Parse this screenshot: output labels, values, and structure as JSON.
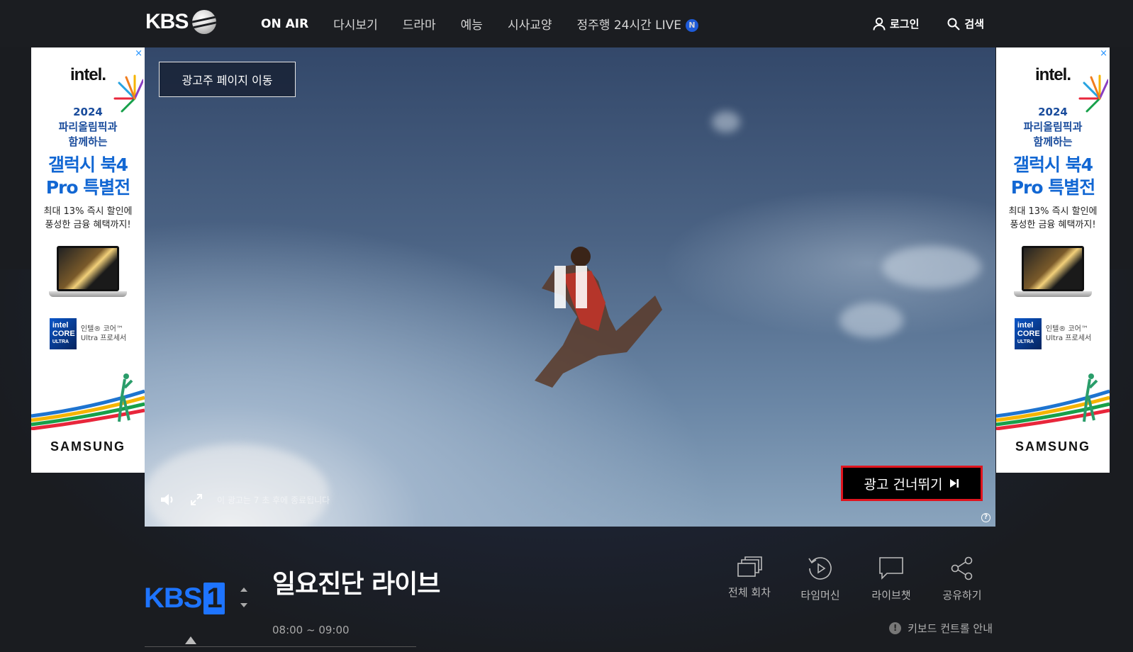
{
  "header": {
    "logo_text": "KBS",
    "nav": [
      {
        "label": "ON AIR",
        "active": true
      },
      {
        "label": "다시보기"
      },
      {
        "label": "드라마"
      },
      {
        "label": "예능"
      },
      {
        "label": "시사교양"
      },
      {
        "label": "정주행 24시간 LIVE",
        "badge": "N"
      }
    ],
    "login_label": "로그인",
    "search_label": "검색"
  },
  "side_ad": {
    "close_symbol": "×",
    "brand": "intel.",
    "year": "2024",
    "line1": "파리올림픽과",
    "line2": "함께하는",
    "headline1": "갤럭시 북4",
    "headline2": "Pro 특별전",
    "desc1": "최대 13% 즉시 할인에",
    "desc2": "풍성한 금융 혜택까지!",
    "chip_badge_line1": "intel",
    "chip_badge_line2": "CORE",
    "chip_badge_line3": "ULTRA",
    "chip_text_line1": "인텔® 코어™",
    "chip_text_line2": "Ultra 프로세서",
    "maker": "SAMSUNG"
  },
  "player": {
    "advertiser_button": "광고주 페이지 이동",
    "skip_button": "광고 건너뛰기",
    "ad_countdown": "이 광고는 7 초 후에 종료됩니다",
    "state": "paused",
    "help_symbol": "?"
  },
  "program": {
    "channel_logo": "KBS",
    "channel_number": "1",
    "title": "일요진단 라이브",
    "time": "08:00 ~ 09:00"
  },
  "actions": [
    {
      "label": "전체 회차",
      "icon": "episodes-icon"
    },
    {
      "label": "타임머신",
      "icon": "timemachine-icon"
    },
    {
      "label": "라이브챗",
      "icon": "chat-icon"
    },
    {
      "label": "공유하기",
      "icon": "share-icon"
    }
  ],
  "keyboard_guide": "키보드 컨트롤 안내",
  "colors": {
    "background": "#1a1c20",
    "accent_blue": "#1e74ff",
    "skip_border": "#e0141e"
  }
}
